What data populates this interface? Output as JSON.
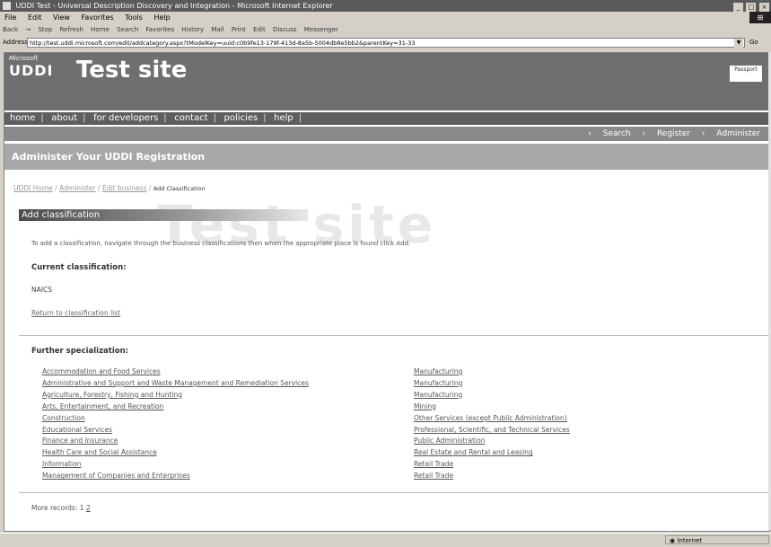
{
  "window": {
    "title": "UDDI Test - Universal Description Discovery and Integration - Microsoft Internet Explorer",
    "controls": [
      "_",
      "□",
      "×"
    ]
  },
  "menu": [
    "File",
    "Edit",
    "View",
    "Favorites",
    "Tools",
    "Help"
  ],
  "toolbar": [
    "Back",
    "→",
    "Stop",
    "Refresh",
    "Home",
    "Search",
    "Favorites",
    "History",
    "Mail",
    "Print",
    "Edit",
    "Discuss",
    "Messenger"
  ],
  "address": {
    "label": "Address",
    "value": "http://test.uddi.microsoft.com/edit/addcategory.aspx?tModelKey=uuid:c0b9fe13-179f-413d-8a5b-5004db8e5bb2&parentKey=31-33"
  },
  "banner": {
    "ms_label": "Microsoft",
    "uddi_label": "UDDI",
    "site_title": "Test site",
    "passport": "Passport"
  },
  "nav": {
    "items": [
      "home",
      "about",
      "for developers",
      "contact",
      "policies",
      "help"
    ]
  },
  "subnav": {
    "search": "Search",
    "register": "Register",
    "administer": "Administer"
  },
  "header": {
    "title": "Administer Your UDDI Registration"
  },
  "breadcrumb": {
    "links": [
      "UDDI Home",
      "Administer",
      "Edit business"
    ],
    "current": "Add Classification"
  },
  "watermark": "Test site",
  "section": {
    "title": "Add classification",
    "description": "To add a classification, navigate through the business classifications then when the appropriate place is found click Add.",
    "current_label": "Current classification:",
    "current_value": "NAICS",
    "return_link": "Return to classification list"
  },
  "further": {
    "label": "Further specialization:",
    "left": [
      "Accommodation and Food Services",
      "Administrative and Support and Waste Management and Remediation Services",
      "Agriculture, Forestry, Fishing and Hunting",
      "Arts, Entertainment, and Recreation",
      "Construction",
      "Educational Services",
      "Finance and Insurance",
      "Health Care and Social Assistance",
      "Information",
      "Management of Companies and Enterprises"
    ],
    "right": [
      "Manufacturing",
      "Manufacturing",
      "Manufacturing",
      "Mining",
      "Other Services (except Public Administration)",
      "Professional, Scientific, and Technical Services",
      "Public Administration",
      "Real Estate and Rental and Leasing",
      "Retail Trade",
      "Retail Trade"
    ]
  },
  "more": {
    "label": "More records:",
    "page1": "1",
    "page2": "2"
  },
  "status": {
    "left": "",
    "zone": "Internet"
  }
}
